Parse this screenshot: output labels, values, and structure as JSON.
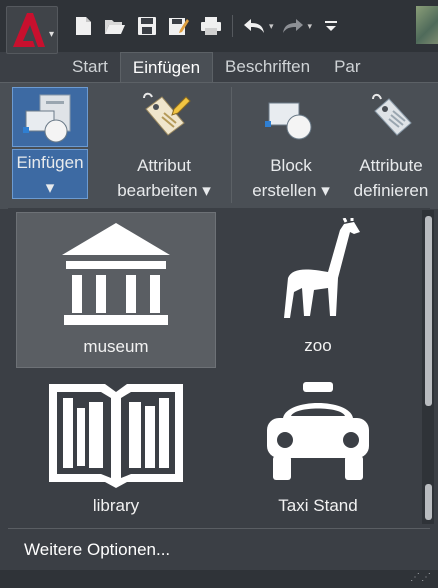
{
  "quick_access": {
    "items": [
      "app-menu-icon",
      "new-icon",
      "open-icon",
      "save-icon",
      "save-as-icon",
      "plot-icon",
      "undo-icon",
      "redo-icon",
      "customize-icon"
    ]
  },
  "tabs": [
    {
      "label": "Start"
    },
    {
      "label": "Einfügen",
      "active": true
    },
    {
      "label": "Beschriften"
    },
    {
      "label": "Par"
    }
  ],
  "ribbon": {
    "einfuegen": {
      "label": "Einfügen"
    },
    "attr_edit": {
      "line1": "Attribut",
      "line2": "bearbeiten"
    },
    "block_create": {
      "line1": "Block",
      "line2": "erstellen"
    },
    "attr_define": {
      "line1": "Attribute",
      "line2": "definieren"
    }
  },
  "gallery": {
    "tiles": [
      {
        "label": "museum",
        "icon": "museum-icon",
        "selected": true
      },
      {
        "label": "zoo",
        "icon": "giraffe-icon"
      },
      {
        "label": "library",
        "icon": "book-icon"
      },
      {
        "label": "Taxi Stand",
        "icon": "taxi-icon"
      }
    ],
    "more_options": "Weitere Optionen..."
  },
  "colors": {
    "background": "#3b3f45",
    "ribbon": "#4a4f55",
    "selection": "#3d6aa3",
    "autocad_red": "#c8102e"
  }
}
